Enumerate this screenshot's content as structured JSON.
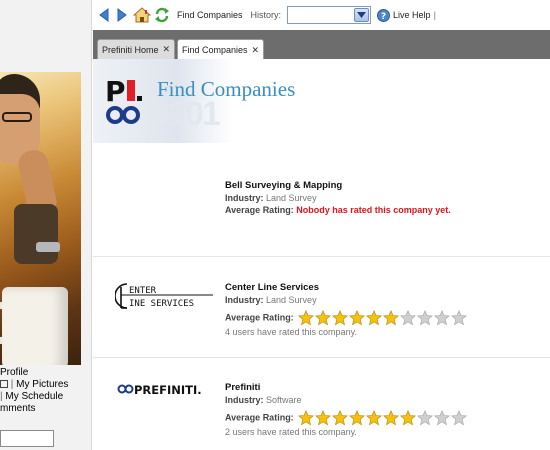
{
  "toolbar": {
    "title": "Find Companies",
    "history_label": "History:",
    "history_value": "",
    "help_label": "Live Help",
    "separator": "|"
  },
  "tabs": [
    {
      "label": "Prefiniti Home",
      "active": false
    },
    {
      "label": "Find Companies",
      "active": true
    }
  ],
  "sidebar": {
    "link_profile": "Profile",
    "link_pictures": "My Pictures",
    "link_schedule": "My Schedule",
    "link_comments": "mments",
    "separator": "|",
    "photo_alt": "man resting head on hand next to coffee mug"
  },
  "page": {
    "title": "Find Companies"
  },
  "companies": [
    {
      "name": "Bell Surveying & Mapping",
      "industry_label": "Industry:",
      "industry": "Land Survey",
      "rating_label": "Average Rating:",
      "rating_text": "Nobody has rated this company yet."
    },
    {
      "name": "Center Line Services",
      "logo_text_1": "ENTER",
      "logo_text_2": "INE SERVICES",
      "industry_label": "Industry:",
      "industry": "Land Survey",
      "rating_label": "Average Rating:",
      "rating": 6,
      "rating_max": 10,
      "users_text": "4 users have rated this company."
    },
    {
      "name": "Prefiniti",
      "logo_text": "PREFINITI.",
      "industry_label": "Industry:",
      "industry": "Software",
      "rating_label": "Average Rating:",
      "rating": 7,
      "rating_max": 10,
      "users_text": "2 users have rated this company."
    }
  ],
  "colors": {
    "accent_title": "#3a8fc0",
    "star_filled": "#f4c20d",
    "star_empty": "#cfcfcf",
    "no_rating": "#e3131b",
    "tab_bar": "#6d6d6d"
  }
}
